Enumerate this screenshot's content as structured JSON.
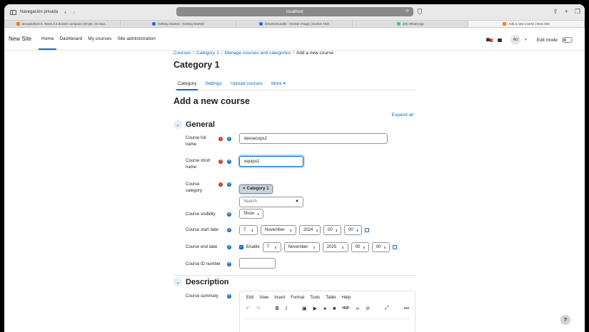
{
  "browser": {
    "private_label": "Navegación privada",
    "url": "localhost",
    "tabs": [
      {
        "label": "devops2024-3. Tarea 2.3 docker compose (20 pts. en equi...",
        "icon": "moodle-favicon"
      },
      {
        "label": "Getting Started - Getting Started",
        "icon": "docker-favicon"
      },
      {
        "label": "bitnami/moodle - Docker Image | Docker Hub",
        "icon": "docker-favicon"
      },
      {
        "label": "(26) WhatsApp",
        "icon": "whatsapp-favicon"
      },
      {
        "label": "Add a new course | New Site",
        "icon": "moodle-favicon"
      }
    ]
  },
  "navbar": {
    "site_name": "New Site",
    "links": [
      "Home",
      "Dashboard",
      "My courses",
      "Site administration"
    ],
    "notification_count": "1",
    "avatar_initials": "AU",
    "edit_mode_label": "Edit mode"
  },
  "breadcrumb": [
    "Courses",
    "Category 1",
    "Manage courses and categories",
    "Add a new course"
  ],
  "category_title": "Category 1",
  "secondary_nav": [
    "Category",
    "Settings",
    "Upload courses",
    "More"
  ],
  "page_heading": "Add a new course",
  "expand_all": "Expand all",
  "general": {
    "title": "General",
    "full_name_label": "Course full name",
    "full_name_value": "devsecops2",
    "short_name_label": "Course short name",
    "short_name_value": "equipo2",
    "category_label": "Course category",
    "category_tag": "Category 1",
    "category_search_placeholder": "Search",
    "visibility_label": "Course visibility",
    "visibility_value": "Show",
    "start_label": "Course start date",
    "start": {
      "day": "7",
      "month": "November",
      "year": "2024",
      "hour": "00",
      "minute": "00"
    },
    "end_label": "Course end date",
    "end_enable": "Enable",
    "end": {
      "day": "7",
      "month": "November",
      "year": "2025",
      "hour": "00",
      "minute": "00"
    },
    "id_label": "Course ID number"
  },
  "description": {
    "title": "Description",
    "summary_label": "Course summary",
    "editor_menu": [
      "Edit",
      "View",
      "Insert",
      "Format",
      "Tools",
      "Table",
      "Help"
    ]
  },
  "colors": {
    "brand": "#0f6cbf",
    "required": "#ca3120"
  }
}
